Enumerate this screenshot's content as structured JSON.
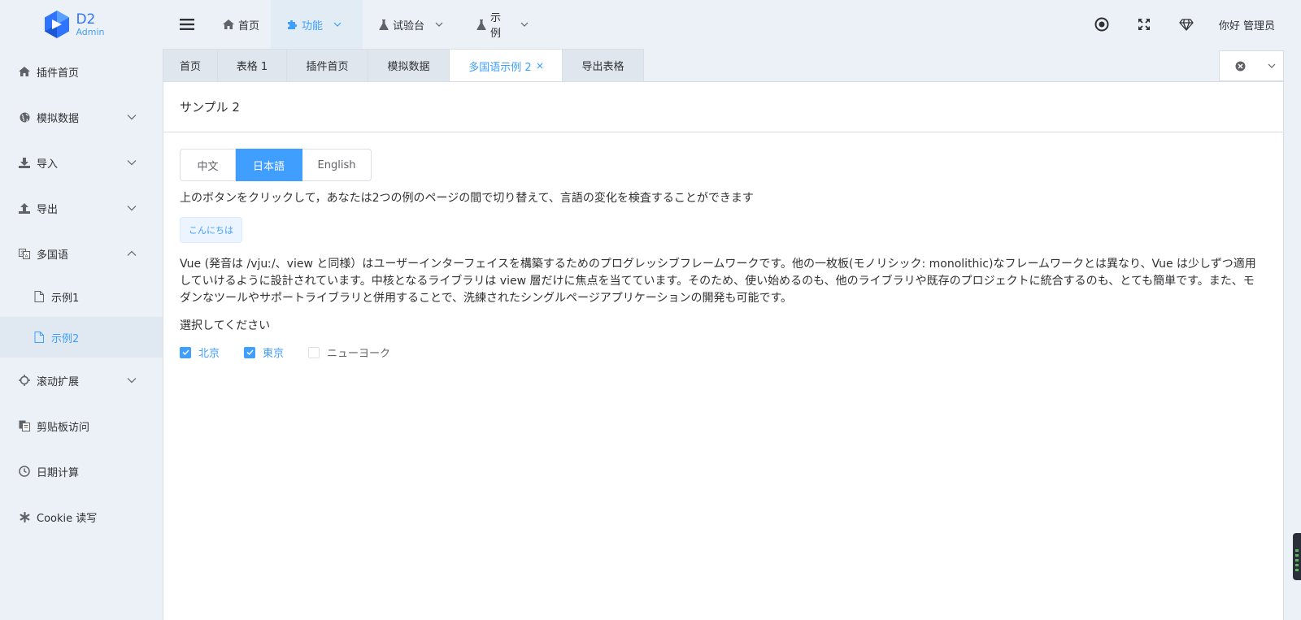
{
  "logo": {
    "title": "D2",
    "subtitle": "Admin"
  },
  "header": {
    "menu": [
      {
        "label": "首页",
        "icon": "home-icon"
      },
      {
        "label": "功能",
        "icon": "puzzle-icon",
        "active": true
      },
      {
        "label": "试验台",
        "icon": "flask-icon"
      },
      {
        "label": "示例",
        "icon": "flask-icon"
      }
    ],
    "user": "你好 管理员"
  },
  "sidebar": {
    "items": [
      {
        "label": "插件首页",
        "icon": "home-icon"
      },
      {
        "label": "模拟数据",
        "icon": "globe-icon"
      },
      {
        "label": "导入",
        "icon": "download-icon"
      },
      {
        "label": "导出",
        "icon": "upload-icon"
      },
      {
        "label": "多国语",
        "icon": "language-icon"
      },
      {
        "label": "滚动扩展",
        "icon": "crosshair-icon"
      },
      {
        "label": "剪贴板访问",
        "icon": "clipboard-icon"
      },
      {
        "label": "日期计算",
        "icon": "clock-icon"
      },
      {
        "label": "Cookie 读写",
        "icon": "asterisk-icon"
      }
    ],
    "subitems": [
      {
        "label": "示例1",
        "icon": "file-icon"
      },
      {
        "label": "示例2",
        "icon": "file-icon",
        "active": true
      }
    ]
  },
  "tabs": [
    {
      "label": "首页"
    },
    {
      "label": "表格 1"
    },
    {
      "label": "插件首页"
    },
    {
      "label": "模拟数据"
    },
    {
      "label": "多国语示例 2",
      "active": true
    },
    {
      "label": "导出表格"
    }
  ],
  "panel": {
    "title": "サンプル 2",
    "languages": [
      "中文",
      "日本語",
      "English"
    ],
    "selected_language": "日本語",
    "hint": "上のボタンをクリックして，あなたは2つの例のページの間で切り替えて、言語の変化を検査することができます",
    "tag": "こんにちは",
    "paragraph": "Vue (発音は /vjuː/、view と同様）はユーザーインターフェイスを構築するためのプログレッシブフレームワークです。他の一枚板(モノリシック: monolithic)なフレームワークとは異なり、Vue は少しずつ適用していけるように設計されています。中核となるライブラリは view 層だけに焦点を当てています。そのため、使い始めるのも、他のライブラリや既存のプロジェクトに統合するのも、とても簡単です。また、モダンなツールやサポートライブラリと併用することで、洗練されたシングルページアプリケーションの開発も可能です。",
    "select_label": "選択してください",
    "checkboxes": [
      {
        "label": "北京",
        "checked": true
      },
      {
        "label": "東京",
        "checked": true
      },
      {
        "label": "ニューヨーク",
        "checked": false
      }
    ]
  },
  "colors": {
    "primary": "#409eff",
    "background": "#ebf1f6",
    "border": "#d7dee6"
  }
}
